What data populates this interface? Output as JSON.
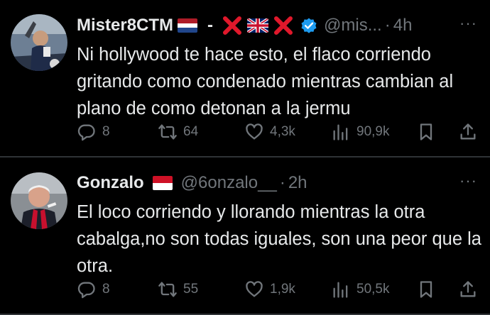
{
  "tweets": [
    {
      "name": "Mister8CTM",
      "name_suffix": "-",
      "handle": "@mis...",
      "time": "4h",
      "text": "Ni hollywood te hace esto, el flaco corriendo gritando como condenado mientras cambian al plano de como detonan a la jermu",
      "replies": "8",
      "retweets": "64",
      "likes": "4,3k",
      "views": "90,9k",
      "verified": true
    },
    {
      "name": "Gonzalo",
      "handle": "@6onzalo__",
      "time": "2h",
      "text": "El loco corriendo y llorando mientras la otra cabalga,no son todas iguales, son una peor que la otra.",
      "replies": "8",
      "retweets": "55",
      "likes": "1,9k",
      "views": "50,5k",
      "verified": false
    }
  ],
  "more_label": "···",
  "dot": "·",
  "colors": {
    "background": "#000000",
    "text": "#e7e9ea",
    "secondary": "#71767b",
    "verified": "#1d9bf0",
    "cross": "#e0182b"
  }
}
